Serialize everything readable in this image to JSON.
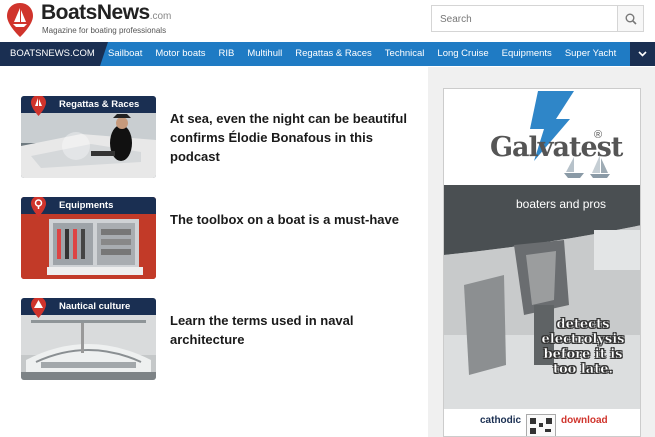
{
  "header": {
    "site_name": "BoatsNews",
    "site_tld": ".com",
    "tagline": "Magazine for boating professionals",
    "search_placeholder": "Search"
  },
  "nav": {
    "brand": "BOATSNEWS.COM",
    "items": [
      "Sailboat",
      "Motor boats",
      "RIB",
      "Multihull",
      "Regattas & Races",
      "Technical",
      "Long Cruise",
      "Equipments",
      "Super Yacht"
    ]
  },
  "articles": [
    {
      "category": "Regattas & Races",
      "title": "At sea, even the night can be beautiful confirms Élodie Bonafous in this podcast"
    },
    {
      "category": "Equipments",
      "title": "The toolbox on a boat is a must-have"
    },
    {
      "category": "Nautical culture",
      "title": "Learn the terms used in naval architecture"
    }
  ],
  "ad": {
    "brand": "Galvatest",
    "reg": "®",
    "slogan": "boaters and pros",
    "message": "detects electrolysis before it is too late.",
    "footer_left": "cathodic",
    "footer_right": "download"
  },
  "colors": {
    "nav_blue": "#1f7bc4",
    "navy": "#1a2f52",
    "brand_red": "#d0342c"
  }
}
